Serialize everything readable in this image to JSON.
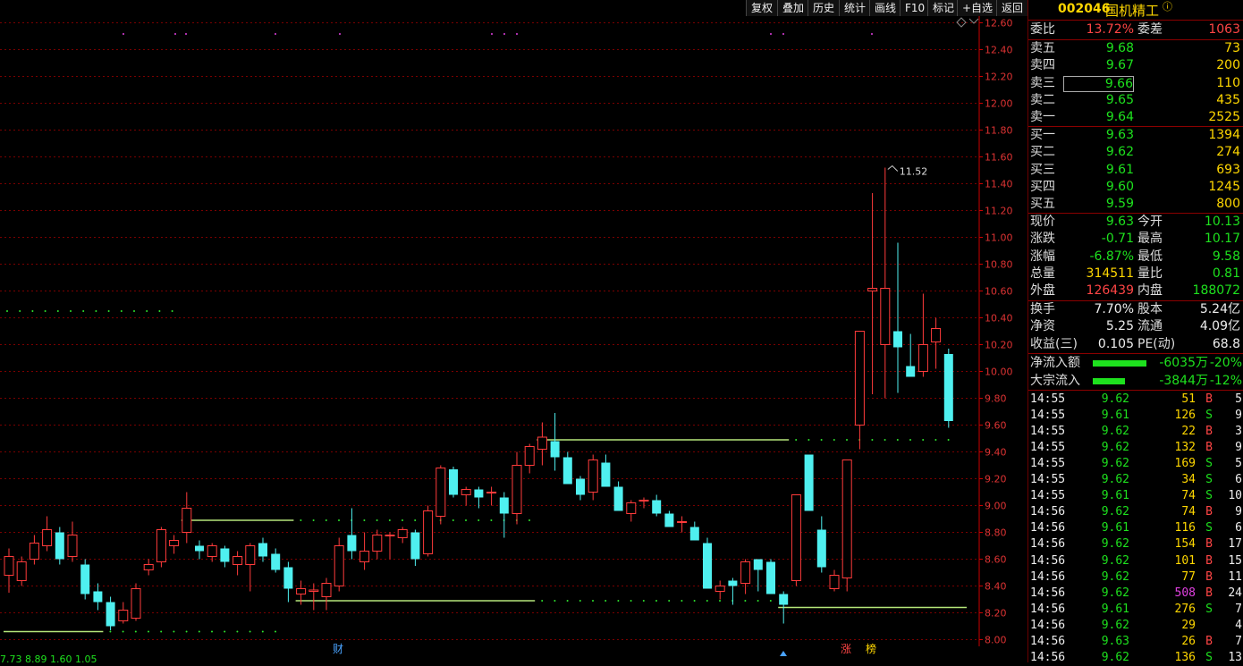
{
  "toolbar": [
    "复权",
    "叠加",
    "历史",
    "统计",
    "画线",
    "F10",
    "标记",
    "+自选",
    "返回"
  ],
  "stock": {
    "code": "002046",
    "name": "国机精工",
    "info_icon": "info-circle-icon"
  },
  "weibi": {
    "label1": "委比",
    "val1": "13.72%",
    "label2": "委差",
    "val2": "1063"
  },
  "asks": [
    {
      "label": "卖五",
      "price": "9.68",
      "vol": "73"
    },
    {
      "label": "卖四",
      "price": "9.67",
      "vol": "200"
    },
    {
      "label": "卖三",
      "price": "9.66",
      "vol": "110"
    },
    {
      "label": "卖二",
      "price": "9.65",
      "vol": "435"
    },
    {
      "label": "卖一",
      "price": "9.64",
      "vol": "2525"
    }
  ],
  "bids": [
    {
      "label": "买一",
      "price": "9.63",
      "vol": "1394"
    },
    {
      "label": "买二",
      "price": "9.62",
      "vol": "274"
    },
    {
      "label": "买三",
      "price": "9.61",
      "vol": "693"
    },
    {
      "label": "买四",
      "price": "9.60",
      "vol": "1245"
    },
    {
      "label": "买五",
      "price": "9.59",
      "vol": "800"
    }
  ],
  "quote": [
    {
      "l1": "现价",
      "v1": "9.63",
      "c1": "g",
      "l2": "今开",
      "v2": "10.13",
      "c2": "g"
    },
    {
      "l1": "涨跌",
      "v1": "-0.71",
      "c1": "g",
      "l2": "最高",
      "v2": "10.17",
      "c2": "g"
    },
    {
      "l1": "涨幅",
      "v1": "-6.87%",
      "c1": "g",
      "l2": "最低",
      "v2": "9.58",
      "c2": "g"
    },
    {
      "l1": "总量",
      "v1": "314511",
      "c1": "y",
      "l2": "量比",
      "v2": "0.81",
      "c2": "g"
    },
    {
      "l1": "外盘",
      "v1": "126439",
      "c1": "r",
      "l2": "内盘",
      "v2": "188072",
      "c2": "g"
    }
  ],
  "fund": [
    {
      "l1": "换手",
      "v1": "7.70%",
      "l2": "股本",
      "v2": "5.24亿"
    },
    {
      "l1": "净资",
      "v1": "5.25",
      "l2": "流通",
      "v2": "4.09亿"
    },
    {
      "l1": "收益(三)",
      "v1": "0.105",
      "l2": "PE(动)",
      "v2": "68.8"
    }
  ],
  "flow": [
    {
      "label": "净流入额",
      "value": "-6035万",
      "pct": "-20%",
      "bar": 0.2
    },
    {
      "label": "大宗流入",
      "value": "-3844万",
      "pct": "-12%",
      "bar": 0.12
    }
  ],
  "ticks": [
    {
      "t": "14:55",
      "p": "9.62",
      "v": "51",
      "d": "B",
      "n": "5"
    },
    {
      "t": "14:55",
      "p": "9.61",
      "v": "126",
      "d": "S",
      "n": "9"
    },
    {
      "t": "14:55",
      "p": "9.62",
      "v": "22",
      "d": "B",
      "n": "3"
    },
    {
      "t": "14:55",
      "p": "9.62",
      "v": "132",
      "d": "B",
      "n": "9"
    },
    {
      "t": "14:55",
      "p": "9.62",
      "v": "169",
      "d": "S",
      "n": "5"
    },
    {
      "t": "14:55",
      "p": "9.62",
      "v": "34",
      "d": "S",
      "n": "6"
    },
    {
      "t": "14:55",
      "p": "9.61",
      "v": "74",
      "d": "S",
      "n": "10"
    },
    {
      "t": "14:56",
      "p": "9.62",
      "v": "74",
      "d": "B",
      "n": "9"
    },
    {
      "t": "14:56",
      "p": "9.61",
      "v": "116",
      "d": "S",
      "n": "6"
    },
    {
      "t": "14:56",
      "p": "9.62",
      "v": "154",
      "d": "B",
      "n": "17"
    },
    {
      "t": "14:56",
      "p": "9.62",
      "v": "101",
      "d": "B",
      "n": "15"
    },
    {
      "t": "14:56",
      "p": "9.62",
      "v": "77",
      "d": "B",
      "n": "11"
    },
    {
      "t": "14:56",
      "p": "9.62",
      "v": "508",
      "d": "B",
      "n": "24",
      "big": true
    },
    {
      "t": "14:56",
      "p": "9.61",
      "v": "276",
      "d": "S",
      "n": "7"
    },
    {
      "t": "14:56",
      "p": "9.62",
      "v": "29",
      "d": "",
      "n": "4"
    },
    {
      "t": "14:56",
      "p": "9.63",
      "v": "26",
      "d": "B",
      "n": "7"
    },
    {
      "t": "14:56",
      "p": "9.62",
      "v": "136",
      "d": "S",
      "n": "13"
    }
  ],
  "chart_data": {
    "type": "candlestick",
    "y_ticks": [
      "12.60",
      "12.40",
      "12.20",
      "12.00",
      "11.80",
      "11.60",
      "11.40",
      "11.20",
      "11.00",
      "10.80",
      "10.60",
      "10.40",
      "10.20",
      "10.00",
      "9.80",
      "9.60",
      "9.40",
      "9.20",
      "9.00",
      "8.80",
      "8.60",
      "8.40",
      "8.20",
      "8.00"
    ],
    "ylim": [
      7.95,
      12.65
    ],
    "high_marker": "11.52",
    "candles": [
      {
        "o": 8.48,
        "h": 8.68,
        "l": 8.35,
        "c": 8.62
      },
      {
        "o": 8.44,
        "h": 8.62,
        "l": 8.4,
        "c": 8.58
      },
      {
        "o": 8.6,
        "h": 8.78,
        "l": 8.56,
        "c": 8.72
      },
      {
        "o": 8.7,
        "h": 8.92,
        "l": 8.66,
        "c": 8.82
      },
      {
        "o": 8.8,
        "h": 8.84,
        "l": 8.56,
        "c": 8.6
      },
      {
        "o": 8.62,
        "h": 8.88,
        "l": 8.58,
        "c": 8.78
      },
      {
        "o": 8.56,
        "h": 8.6,
        "l": 8.3,
        "c": 8.34
      },
      {
        "o": 8.36,
        "h": 8.42,
        "l": 8.22,
        "c": 8.28
      },
      {
        "o": 8.28,
        "h": 8.32,
        "l": 8.07,
        "c": 8.1
      },
      {
        "o": 8.14,
        "h": 8.28,
        "l": 8.12,
        "c": 8.22
      },
      {
        "o": 8.16,
        "h": 8.42,
        "l": 8.14,
        "c": 8.38
      },
      {
        "o": 8.52,
        "h": 8.6,
        "l": 8.48,
        "c": 8.56
      },
      {
        "o": 8.58,
        "h": 8.84,
        "l": 8.54,
        "c": 8.82
      },
      {
        "o": 8.7,
        "h": 8.78,
        "l": 8.64,
        "c": 8.74
      },
      {
        "o": 8.8,
        "h": 9.1,
        "l": 8.72,
        "c": 8.98
      },
      {
        "o": 8.7,
        "h": 8.74,
        "l": 8.6,
        "c": 8.66
      },
      {
        "o": 8.62,
        "h": 8.72,
        "l": 8.58,
        "c": 8.7
      },
      {
        "o": 8.68,
        "h": 8.7,
        "l": 8.54,
        "c": 8.58
      },
      {
        "o": 8.56,
        "h": 8.66,
        "l": 8.48,
        "c": 8.62
      },
      {
        "o": 8.56,
        "h": 8.72,
        "l": 8.36,
        "c": 8.7
      },
      {
        "o": 8.72,
        "h": 8.76,
        "l": 8.58,
        "c": 8.62
      },
      {
        "o": 8.64,
        "h": 8.68,
        "l": 8.5,
        "c": 8.52
      },
      {
        "o": 8.54,
        "h": 8.58,
        "l": 8.28,
        "c": 8.38
      },
      {
        "o": 8.34,
        "h": 8.44,
        "l": 8.26,
        "c": 8.38
      },
      {
        "o": 8.36,
        "h": 8.42,
        "l": 8.22,
        "c": 8.37
      },
      {
        "o": 8.32,
        "h": 8.46,
        "l": 8.22,
        "c": 8.42
      },
      {
        "o": 8.4,
        "h": 8.76,
        "l": 8.36,
        "c": 8.7
      },
      {
        "o": 8.78,
        "h": 8.98,
        "l": 8.6,
        "c": 8.66
      },
      {
        "o": 8.58,
        "h": 8.8,
        "l": 8.52,
        "c": 8.66
      },
      {
        "o": 8.66,
        "h": 8.82,
        "l": 8.6,
        "c": 8.78
      },
      {
        "o": 8.78,
        "h": 8.8,
        "l": 8.6,
        "c": 8.78
      },
      {
        "o": 8.76,
        "h": 8.84,
        "l": 8.72,
        "c": 8.82
      },
      {
        "o": 8.8,
        "h": 8.82,
        "l": 8.55,
        "c": 8.6
      },
      {
        "o": 8.64,
        "h": 9.0,
        "l": 8.62,
        "c": 8.96
      },
      {
        "o": 8.92,
        "h": 9.3,
        "l": 8.86,
        "c": 9.28
      },
      {
        "o": 9.27,
        "h": 9.29,
        "l": 9.06,
        "c": 9.08
      },
      {
        "o": 9.08,
        "h": 9.14,
        "l": 9.0,
        "c": 9.12
      },
      {
        "o": 9.12,
        "h": 9.14,
        "l": 8.98,
        "c": 9.06
      },
      {
        "o": 9.1,
        "h": 9.14,
        "l": 9.0,
        "c": 9.1
      },
      {
        "o": 9.06,
        "h": 9.1,
        "l": 8.76,
        "c": 8.94
      },
      {
        "o": 8.94,
        "h": 9.4,
        "l": 8.86,
        "c": 9.3
      },
      {
        "o": 9.3,
        "h": 9.46,
        "l": 9.24,
        "c": 9.44
      },
      {
        "o": 9.42,
        "h": 9.62,
        "l": 9.3,
        "c": 9.51
      },
      {
        "o": 9.48,
        "h": 9.69,
        "l": 9.26,
        "c": 9.36
      },
      {
        "o": 9.36,
        "h": 9.4,
        "l": 9.16,
        "c": 9.16
      },
      {
        "o": 9.2,
        "h": 9.22,
        "l": 9.04,
        "c": 9.08
      },
      {
        "o": 9.1,
        "h": 9.38,
        "l": 9.04,
        "c": 9.34
      },
      {
        "o": 9.32,
        "h": 9.38,
        "l": 9.14,
        "c": 9.14
      },
      {
        "o": 9.14,
        "h": 9.18,
        "l": 8.96,
        "c": 8.96
      },
      {
        "o": 8.94,
        "h": 9.04,
        "l": 8.88,
        "c": 9.02
      },
      {
        "o": 9.04,
        "h": 9.06,
        "l": 8.98,
        "c": 9.04
      },
      {
        "o": 9.04,
        "h": 9.08,
        "l": 8.92,
        "c": 8.94
      },
      {
        "o": 8.94,
        "h": 8.96,
        "l": 8.84,
        "c": 8.84
      },
      {
        "o": 8.88,
        "h": 8.92,
        "l": 8.8,
        "c": 8.88
      },
      {
        "o": 8.84,
        "h": 8.88,
        "l": 8.74,
        "c": 8.74
      },
      {
        "o": 8.72,
        "h": 8.76,
        "l": 8.38,
        "c": 8.38
      },
      {
        "o": 8.36,
        "h": 8.44,
        "l": 8.3,
        "c": 8.4
      },
      {
        "o": 8.44,
        "h": 8.46,
        "l": 8.26,
        "c": 8.4
      },
      {
        "o": 8.42,
        "h": 8.6,
        "l": 8.34,
        "c": 8.58
      },
      {
        "o": 8.6,
        "h": 8.6,
        "l": 8.36,
        "c": 8.52
      },
      {
        "o": 8.58,
        "h": 8.6,
        "l": 8.34,
        "c": 8.34
      },
      {
        "o": 8.34,
        "h": 8.36,
        "l": 8.12,
        "c": 8.26
      },
      {
        "o": 8.44,
        "h": 9.08,
        "l": 8.4,
        "c": 9.08
      },
      {
        "o": 9.38,
        "h": 9.38,
        "l": 8.96,
        "c": 8.96
      },
      {
        "o": 8.82,
        "h": 8.92,
        "l": 8.5,
        "c": 8.54
      },
      {
        "o": 8.38,
        "h": 8.52,
        "l": 8.36,
        "c": 8.48
      },
      {
        "o": 8.46,
        "h": 9.34,
        "l": 8.36,
        "c": 9.34
      },
      {
        "o": 9.6,
        "h": 10.3,
        "l": 9.42,
        "c": 10.3
      },
      {
        "o": 10.6,
        "h": 11.33,
        "l": 9.83,
        "c": 10.62
      },
      {
        "o": 10.2,
        "h": 11.52,
        "l": 9.8,
        "c": 10.62
      },
      {
        "o": 10.3,
        "h": 10.96,
        "l": 9.84,
        "c": 10.18
      },
      {
        "o": 10.04,
        "h": 10.28,
        "l": 9.96,
        "c": 9.96
      },
      {
        "o": 10.0,
        "h": 10.58,
        "l": 9.96,
        "c": 10.2
      },
      {
        "o": 10.22,
        "h": 10.4,
        "l": 10.02,
        "c": 10.32
      },
      {
        "o": 10.13,
        "h": 10.17,
        "l": 9.58,
        "c": 9.63
      }
    ],
    "support_lines": [
      {
        "start": 0,
        "end": 7,
        "value": 8.06,
        "ext_end": 21
      },
      {
        "start": 14,
        "end": 22,
        "value": 8.89,
        "ext_end": 41
      },
      {
        "start": 23,
        "end": 41,
        "value": 8.29,
        "ext_end": 61
      },
      {
        "start": 42,
        "end": 61,
        "value": 9.49,
        "ext_end": 74
      },
      {
        "start": 61,
        "end": 75,
        "value": 8.24,
        "ext_end": 75
      },
      {
        "start": 0,
        "end": 13,
        "value": 10.45,
        "ext_end": 13
      }
    ],
    "event_labels": [
      "财",
      "涨",
      "榜"
    ],
    "bottom_legend": [
      "7.73",
      "8.89",
      "1.60",
      "1.05"
    ]
  }
}
